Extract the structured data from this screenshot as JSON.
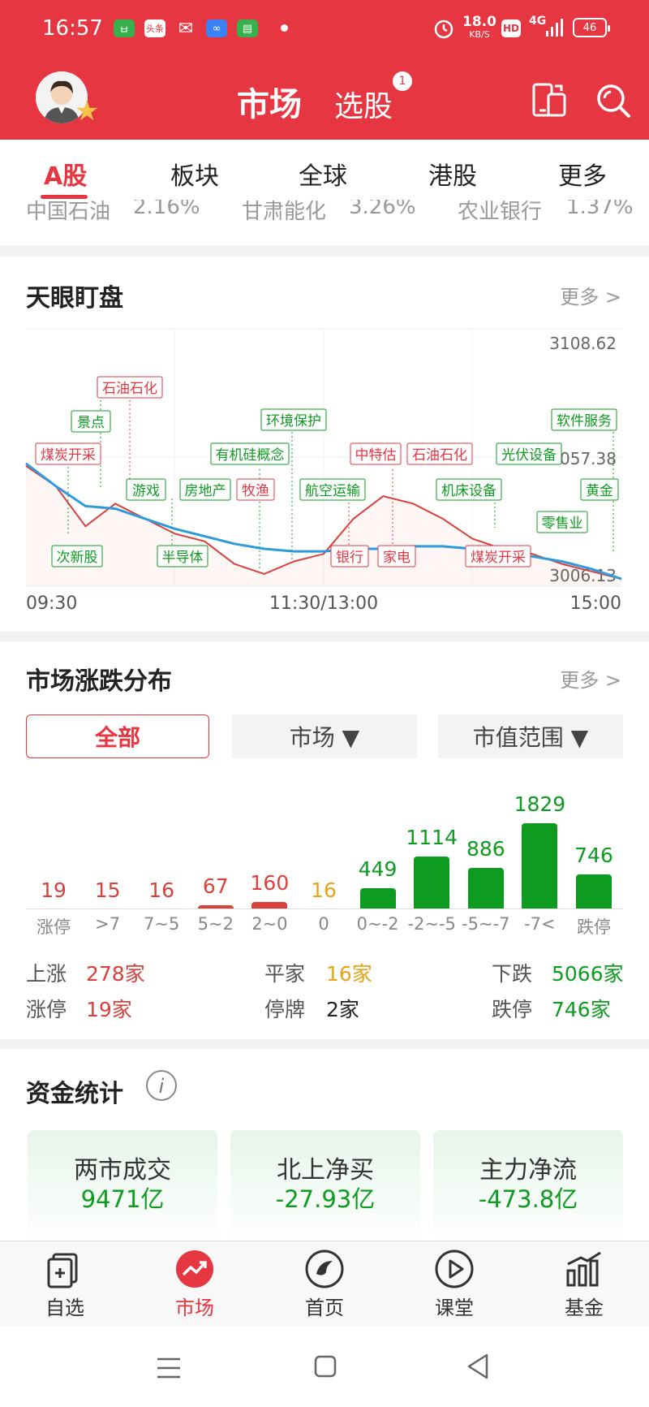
{
  "status_bar": {
    "time": "16:57",
    "net_speed_value": "18.0",
    "net_speed_unit": "KB/S",
    "hd": "HD",
    "signal": "4G",
    "battery": "46",
    "app_icons": [
      "chat-icon",
      "toutiao-icon",
      "wechat-icon",
      "infinity-icon",
      "message-icon"
    ],
    "toutiao_label": "头条"
  },
  "header": {
    "title": "市场",
    "subtitle": "选股",
    "badge": "1"
  },
  "tabs": [
    "A股",
    "板块",
    "全球",
    "港股",
    "更多"
  ],
  "partial_row": [
    {
      "name": "中国石油",
      "pct": "2.16%"
    },
    {
      "name": "甘肃能化",
      "pct": "3.26%"
    },
    {
      "name": "农业银行",
      "pct": "1.37%"
    }
  ],
  "tianyan": {
    "title": "天眼盯盘",
    "more": "更多 >",
    "y_high": "3108.62",
    "y_mid": "3057.38",
    "y_low": "3006.13",
    "x_start": "09:30",
    "x_mid": "11:30/13:00",
    "x_end": "15:00"
  },
  "chart_data": {
    "type": "line",
    "title": "天眼盯盘",
    "x_ticks": [
      "09:30",
      "11:30/13:00",
      "15:00"
    ],
    "y_ticks": [
      3006.13,
      3057.38,
      3108.62
    ],
    "ylim": [
      3006.13,
      3108.62
    ],
    "series": [
      {
        "x": [
          0,
          0.05,
          0.1,
          0.15,
          0.2,
          0.25,
          0.3,
          0.35,
          0.4,
          0.45,
          0.5,
          0.55,
          0.6,
          0.65,
          0.7,
          0.75,
          0.8,
          0.85,
          0.9,
          0.95,
          1.0
        ],
        "values": [
          3054,
          3046,
          3030,
          3039,
          3033,
          3027,
          3024,
          3015,
          3011,
          3016,
          3019,
          3033,
          3042,
          3039,
          3033,
          3025,
          3021,
          3019,
          3015,
          3012,
          3009
        ]
      },
      {
        "x": [
          0,
          0.05,
          0.1,
          0.15,
          0.2,
          0.25,
          0.3,
          0.35,
          0.4,
          0.45,
          0.5,
          0.55,
          0.6,
          0.65,
          0.7,
          0.75,
          0.8,
          0.85,
          0.9,
          0.95,
          1.0
        ],
        "values": [
          3055,
          3046,
          3038,
          3037,
          3033,
          3029,
          3026,
          3023,
          3021,
          3020,
          3020,
          3021,
          3021,
          3022,
          3022,
          3021,
          3020,
          3018,
          3016,
          3013,
          3009
        ]
      }
    ]
  },
  "tianyan_labels": {
    "red": [
      "石油石化",
      "煤炭开采",
      "牧渔",
      "中特估",
      "石油石化",
      "银行",
      "家电",
      "煤炭开采"
    ],
    "green": [
      "景点",
      "游戏",
      "房地产",
      "有机硅概念",
      "环境保护",
      "航空运输",
      "机床设备",
      "光伏设备",
      "软件服务",
      "黄金",
      "零售业",
      "次新股",
      "半导体"
    ]
  },
  "distribution": {
    "title": "市场涨跌分布",
    "more": "更多 >",
    "filters": {
      "all": "全部",
      "market": "市场 ▼",
      "cap": "市值范围 ▼"
    },
    "categories": [
      "涨停",
      ">7",
      "7~5",
      "5~2",
      "2~0",
      "0",
      "0~-2",
      "-2~-5",
      "-5~-7",
      "-7<",
      "跌停"
    ],
    "values": [
      19,
      15,
      16,
      67,
      160,
      16,
      449,
      1114,
      886,
      1829,
      746
    ],
    "colors": {
      "up": "#d9413b",
      "flat": "#e8a317",
      "down": "#0d9c1f"
    },
    "stats": {
      "up_label": "上涨",
      "up_value": "278家",
      "flat_label": "平家",
      "flat_value": "16家",
      "down_label": "下跌",
      "down_value": "5066家",
      "limit_up_label": "涨停",
      "limit_up_value": "19家",
      "halt_label": "停牌",
      "halt_value": "2家",
      "limit_down_label": "跌停",
      "limit_down_value": "746家"
    }
  },
  "funds": {
    "title": "资金统计",
    "cards": [
      {
        "title": "两市成交",
        "value": "9471亿"
      },
      {
        "title": "北上净买",
        "value": "-27.93亿"
      },
      {
        "title": "主力净流",
        "value": "-473.8亿"
      }
    ]
  },
  "bottom_nav": [
    "自选",
    "市场",
    "首页",
    "课堂",
    "基金"
  ]
}
